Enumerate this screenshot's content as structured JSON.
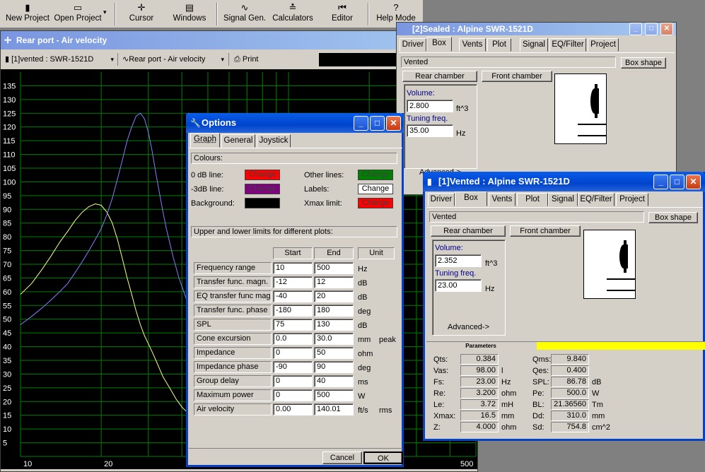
{
  "toolbar": {
    "items": [
      {
        "id": "new",
        "icon": "▮",
        "label": "New Project"
      },
      {
        "id": "open",
        "icon": "▭",
        "label": "Open Project"
      },
      {
        "id": "cursor",
        "icon": "✛",
        "label": "Cursor"
      },
      {
        "id": "windows",
        "icon": "▤",
        "label": "Windows"
      },
      {
        "id": "signal",
        "icon": "∿",
        "label": "Signal Gen."
      },
      {
        "id": "calc",
        "icon": "≛",
        "label": "Calculators"
      },
      {
        "id": "editor",
        "icon": "⏮",
        "label": "Editor"
      },
      {
        "id": "help",
        "icon": "?",
        "label": "Help Mode"
      }
    ],
    "dropdown_arrow": "▾"
  },
  "graph": {
    "title": "Rear port - Air velocity",
    "project_select": "[1]vented : SWR-1521D",
    "plot_select": "Rear port - Air velocity",
    "print_label": "Print",
    "colors": {
      "background": "#000000",
      "grid": "#008000",
      "series1": "#ffff80",
      "series2": "#8080ff"
    }
  },
  "chart_data": {
    "type": "line",
    "xscale": "log",
    "xlim": [
      10,
      500
    ],
    "ylim": [
      0,
      140
    ],
    "yticks": [
      5,
      10,
      15,
      20,
      25,
      30,
      35,
      40,
      45,
      50,
      55,
      60,
      65,
      70,
      75,
      80,
      85,
      90,
      95,
      100,
      105,
      110,
      115,
      120,
      125,
      130,
      135
    ],
    "xtick_labels": [
      {
        "x": 10,
        "label": "10"
      },
      {
        "x": 20,
        "label": "20"
      },
      {
        "x": 500,
        "label": "500"
      }
    ],
    "xgrid": [
      20,
      30,
      40,
      50,
      60,
      70,
      80,
      90,
      100,
      200,
      300,
      400
    ],
    "series": [
      {
        "color": "#ffff80",
        "x": [
          10,
          11,
          12,
          13,
          14,
          15,
          16,
          17,
          18,
          19,
          20,
          21,
          22,
          23,
          24,
          25,
          26,
          27,
          28,
          29,
          30,
          31,
          32,
          33,
          34,
          35,
          36,
          38,
          40,
          42
        ],
        "y": [
          59,
          63,
          68,
          73,
          78,
          82,
          86,
          89,
          91,
          92,
          91.5,
          89,
          85,
          79,
          72,
          65,
          59,
          53,
          48,
          44,
          41,
          38,
          35,
          32,
          29,
          27,
          25,
          21,
          18,
          16
        ]
      },
      {
        "color": "#8080ff",
        "x": [
          10,
          11,
          12,
          13,
          14,
          15,
          16,
          17,
          18,
          19,
          20,
          21,
          22,
          23,
          24,
          25,
          26,
          27,
          28,
          29,
          30,
          31,
          32,
          33,
          34,
          35,
          36,
          37,
          38,
          39,
          40,
          41,
          42
        ],
        "y": [
          48,
          51,
          54,
          57,
          60,
          63,
          67,
          71,
          75,
          79,
          83,
          88,
          94,
          101,
          108,
          115,
          120,
          124,
          125,
          123,
          118,
          111,
          103,
          96,
          89,
          83,
          78,
          73,
          69,
          65,
          62,
          59,
          56
        ]
      }
    ]
  },
  "options": {
    "title": "Options",
    "tabs": [
      "Graph",
      "General",
      "Joystick"
    ],
    "colours_header": "Colours:",
    "colour_rows": [
      {
        "label": "0 dB line:",
        "btn": "Change",
        "color": "#ff0000"
      },
      {
        "label": "-3dB line:",
        "btn": "Change",
        "color": "#800080"
      },
      {
        "label": "Background:",
        "btn": "",
        "color": "#000000"
      },
      {
        "label": "Other lines:",
        "btn": "Change",
        "color": "#008000"
      },
      {
        "label": "Labels:",
        "btn": "Change",
        "color": "#ffffff"
      },
      {
        "label": "Xmax limit:",
        "btn": "Change",
        "color": "#ff0000"
      }
    ],
    "limits_header": "Upper and lower limits for different plots:",
    "cols": [
      "Start",
      "End",
      "Unit"
    ],
    "rows": [
      {
        "name": "Frequency range",
        "start": "10",
        "end": "500",
        "unit": "Hz",
        "extra": ""
      },
      {
        "name": "Transfer func. magn.",
        "start": "-12",
        "end": "12",
        "unit": "dB",
        "extra": ""
      },
      {
        "name": "EQ transfer func mag",
        "start": "-40",
        "end": "20",
        "unit": "dB",
        "extra": ""
      },
      {
        "name": "Transfer func. phase",
        "start": "-180",
        "end": "180",
        "unit": "deg",
        "extra": ""
      },
      {
        "name": "SPL",
        "start": "75",
        "end": "130",
        "unit": "dB",
        "extra": ""
      },
      {
        "name": "Cone excursion",
        "start": "0.0",
        "end": "30.0",
        "unit": "mm",
        "extra": "peak"
      },
      {
        "name": "Impedance",
        "start": "0",
        "end": "50",
        "unit": "ohm",
        "extra": ""
      },
      {
        "name": "Impedance phase",
        "start": "-90",
        "end": "90",
        "unit": "deg",
        "extra": ""
      },
      {
        "name": "Group delay",
        "start": "0",
        "end": "40",
        "unit": "ms",
        "extra": ""
      },
      {
        "name": "Maximum power",
        "start": "0",
        "end": "500",
        "unit": "W",
        "extra": ""
      },
      {
        "name": "Air velocity",
        "start": "0.00",
        "end": "140.01",
        "unit": "ft/s",
        "extra": "rms"
      }
    ],
    "cancel": "Cancel",
    "ok": "OK"
  },
  "box_back": {
    "title": "[2]Sealed : Alpine SWR-1521D",
    "tabs": [
      "Driver",
      "Box",
      "Vents",
      "Plot",
      "Signal",
      "EQ/Filter",
      "Project"
    ],
    "box_type": "Vented",
    "box_shape": "Box shape",
    "rear": "Rear chamber",
    "front": "Front chamber",
    "volume_label": "Volume:",
    "volume": "2.800",
    "volume_unit": "ft^3",
    "tuning_label": "Tuning freq.",
    "tuning": "35.00",
    "tuning_unit": "Hz",
    "advanced": "Advanced->"
  },
  "box_front": {
    "title": "[1]Vented : Alpine SWR-1521D",
    "tabs": [
      "Driver",
      "Box",
      "Vents",
      "Plot",
      "Signal",
      "EQ/Filter",
      "Project"
    ],
    "box_type": "Vented",
    "box_shape": "Box shape",
    "rear": "Rear chamber",
    "front": "Front chamber",
    "volume_label": "Volume:",
    "volume": "2.352",
    "volume_unit": "ft^3",
    "tuning_label": "Tuning freq.",
    "tuning": "23.00",
    "tuning_unit": "Hz",
    "advanced": "Advanced->",
    "params_label": "Parameters",
    "params": [
      {
        "k": "Qts:",
        "v": "0.384",
        "u": "",
        "k2": "Qms:",
        "v2": "9.840",
        "u2": ""
      },
      {
        "k": "Vas:",
        "v": "98.00",
        "u": "l",
        "k2": "Qes:",
        "v2": "0.400",
        "u2": ""
      },
      {
        "k": "Fs:",
        "v": "23.00",
        "u": "Hz",
        "k2": "SPL:",
        "v2": "86.78",
        "u2": "dB"
      },
      {
        "k": "Re:",
        "v": "3.200",
        "u": "ohm",
        "k2": "Pe:",
        "v2": "500.0",
        "u2": "W"
      },
      {
        "k": "Le:",
        "v": "3.72",
        "u": "mH",
        "k2": "BL:",
        "v2": "21.36560",
        "u2": "Tm"
      },
      {
        "k": "Xmax:",
        "v": "16.5",
        "u": "mm",
        "k2": "Dd:",
        "v2": "310.0",
        "u2": "mm"
      },
      {
        "k": "Z:",
        "v": "4.000",
        "u": "ohm",
        "k2": "Sd:",
        "v2": "754.8",
        "u2": "cm^2"
      }
    ]
  }
}
